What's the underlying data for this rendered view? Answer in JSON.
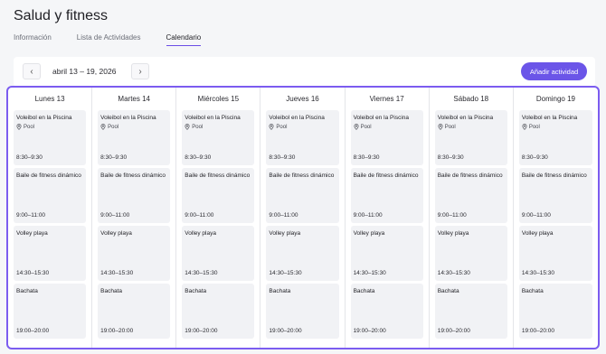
{
  "page": {
    "title": "Salud y fitness"
  },
  "tabs": [
    {
      "label": "Información",
      "active": false
    },
    {
      "label": "Lista de Actividades",
      "active": false
    },
    {
      "label": "Calendario",
      "active": true
    }
  ],
  "toolbar": {
    "date_range": "abril 13 – 19, 2026",
    "prev_icon": "chevron-left-icon",
    "next_icon": "chevron-right-icon",
    "add_label": "Añadir actividad"
  },
  "colors": {
    "accent": "#6b55e8",
    "calendar_border": "#7b5cf0",
    "event_bg": "#f1f2f5"
  },
  "calendar": {
    "days": [
      {
        "label": "Lunes 13"
      },
      {
        "label": "Martes 14"
      },
      {
        "label": "Miércoles 15"
      },
      {
        "label": "Jueves 16"
      },
      {
        "label": "Viernes 17"
      },
      {
        "label": "Sábado 18"
      },
      {
        "label": "Domingo 19"
      }
    ],
    "events": [
      {
        "title": "Voleibol en la Piscina",
        "location": "Pool",
        "time": "8:30–9:30"
      },
      {
        "title": "Baile de fitness dinámico",
        "location": "",
        "time": "9:00–11:00"
      },
      {
        "title": "Volley playa",
        "location": "",
        "time": "14:30–15:30"
      },
      {
        "title": "Bachata",
        "location": "",
        "time": "19:00–20:00"
      }
    ]
  }
}
